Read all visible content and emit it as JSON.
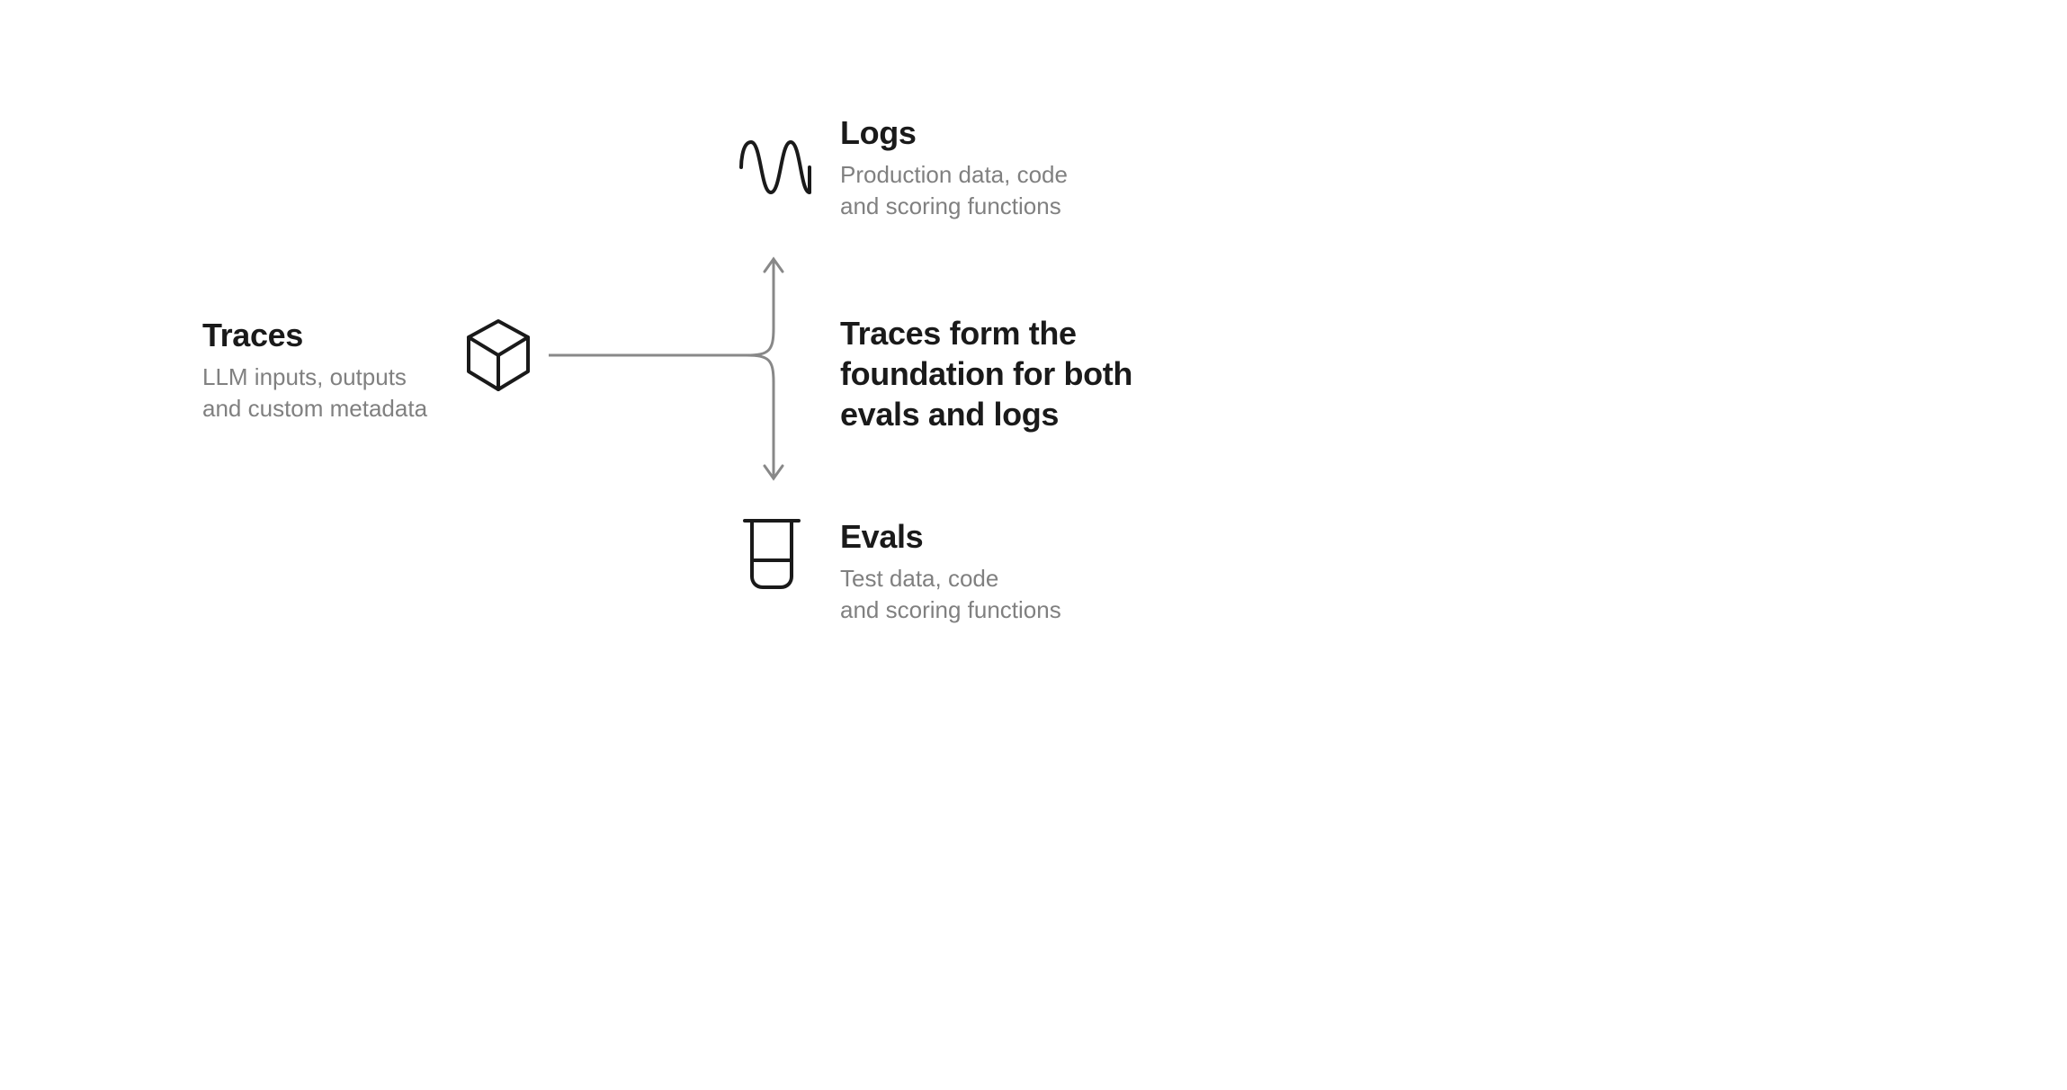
{
  "traces": {
    "title": "Traces",
    "subtitle_line1": "LLM inputs, outputs",
    "subtitle_line2": "and custom metadata",
    "icon": "cube-icon"
  },
  "logs": {
    "title": "Logs",
    "subtitle_line1": "Production data, code",
    "subtitle_line2": "and scoring functions",
    "icon": "waveform-icon"
  },
  "evals": {
    "title": "Evals",
    "subtitle_line1": "Test data, code",
    "subtitle_line2": "and scoring functions",
    "icon": "beaker-icon"
  },
  "center": {
    "line1": "Traces form the",
    "line2": "foundation for both",
    "line3": "evals and logs"
  },
  "colors": {
    "text_primary": "#1a1a1a",
    "text_secondary": "#808080",
    "connector": "#888888",
    "background": "#ffffff"
  }
}
